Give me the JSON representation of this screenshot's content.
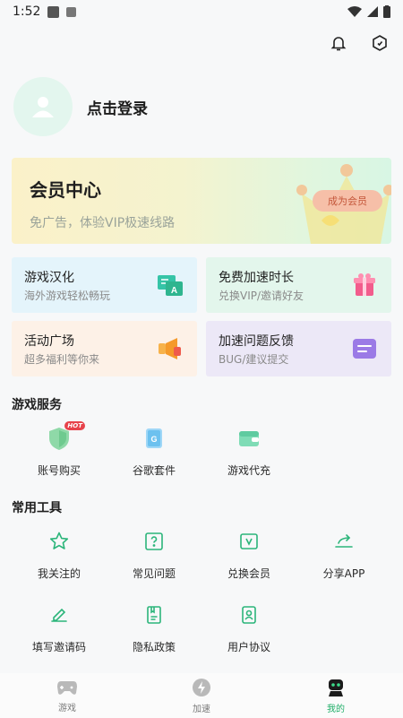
{
  "status": {
    "time": "1:52"
  },
  "profile": {
    "login_label": "点击登录"
  },
  "vip": {
    "title": "会员中心",
    "subtitle": "免广告，体验VIP极速线路",
    "button": "成为会员"
  },
  "cards": [
    {
      "title": "游戏汉化",
      "subtitle": "海外游戏轻松畅玩",
      "icon": "translate-icon"
    },
    {
      "title": "免费加速时长",
      "subtitle": "兑换VIP/邀请好友",
      "icon": "gift-icon"
    },
    {
      "title": "活动广场",
      "subtitle": "超多福利等你来",
      "icon": "megaphone-icon"
    },
    {
      "title": "加速问题反馈",
      "subtitle": "BUG/建议提交",
      "icon": "feedback-icon"
    }
  ],
  "game_services": {
    "title": "游戏服务",
    "items": [
      {
        "label": "账号购买",
        "icon": "shield-hot-icon",
        "badge": "HOT"
      },
      {
        "label": "谷歌套件",
        "icon": "google-suite-icon"
      },
      {
        "label": "游戏代充",
        "icon": "wallet-icon"
      }
    ]
  },
  "tools": {
    "title": "常用工具",
    "items": [
      {
        "label": "我关注的",
        "icon": "star-icon"
      },
      {
        "label": "常见问题",
        "icon": "question-icon"
      },
      {
        "label": "兑换会员",
        "icon": "vip-exchange-icon"
      },
      {
        "label": "分享APP",
        "icon": "share-icon"
      },
      {
        "label": "填写邀请码",
        "icon": "invite-code-icon"
      },
      {
        "label": "隐私政策",
        "icon": "privacy-icon"
      },
      {
        "label": "用户协议",
        "icon": "agreement-icon"
      }
    ]
  },
  "tabs": [
    {
      "label": "游戏",
      "icon": "gamepad-icon"
    },
    {
      "label": "加速",
      "icon": "lightning-icon"
    },
    {
      "label": "我的",
      "icon": "robot-icon",
      "active": true
    }
  ],
  "colors": {
    "accent": "#1fae68",
    "icon_green": "#2bb57a"
  }
}
